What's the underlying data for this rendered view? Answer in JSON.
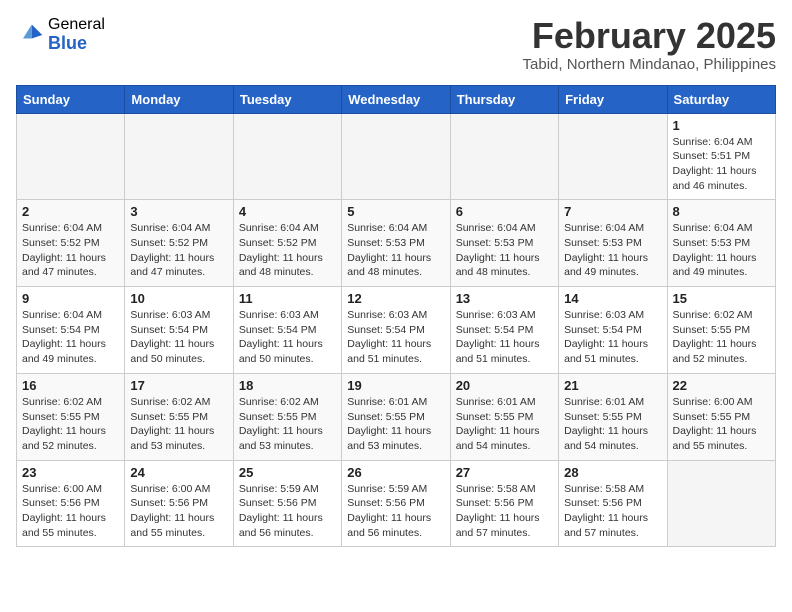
{
  "header": {
    "logo_general": "General",
    "logo_blue": "Blue",
    "month_title": "February 2025",
    "location": "Tabid, Northern Mindanao, Philippines"
  },
  "weekdays": [
    "Sunday",
    "Monday",
    "Tuesday",
    "Wednesday",
    "Thursday",
    "Friday",
    "Saturday"
  ],
  "weeks": [
    [
      {
        "day": "",
        "info": ""
      },
      {
        "day": "",
        "info": ""
      },
      {
        "day": "",
        "info": ""
      },
      {
        "day": "",
        "info": ""
      },
      {
        "day": "",
        "info": ""
      },
      {
        "day": "",
        "info": ""
      },
      {
        "day": "1",
        "info": "Sunrise: 6:04 AM\nSunset: 5:51 PM\nDaylight: 11 hours\nand 46 minutes."
      }
    ],
    [
      {
        "day": "2",
        "info": "Sunrise: 6:04 AM\nSunset: 5:52 PM\nDaylight: 11 hours\nand 47 minutes."
      },
      {
        "day": "3",
        "info": "Sunrise: 6:04 AM\nSunset: 5:52 PM\nDaylight: 11 hours\nand 47 minutes."
      },
      {
        "day": "4",
        "info": "Sunrise: 6:04 AM\nSunset: 5:52 PM\nDaylight: 11 hours\nand 48 minutes."
      },
      {
        "day": "5",
        "info": "Sunrise: 6:04 AM\nSunset: 5:53 PM\nDaylight: 11 hours\nand 48 minutes."
      },
      {
        "day": "6",
        "info": "Sunrise: 6:04 AM\nSunset: 5:53 PM\nDaylight: 11 hours\nand 48 minutes."
      },
      {
        "day": "7",
        "info": "Sunrise: 6:04 AM\nSunset: 5:53 PM\nDaylight: 11 hours\nand 49 minutes."
      },
      {
        "day": "8",
        "info": "Sunrise: 6:04 AM\nSunset: 5:53 PM\nDaylight: 11 hours\nand 49 minutes."
      }
    ],
    [
      {
        "day": "9",
        "info": "Sunrise: 6:04 AM\nSunset: 5:54 PM\nDaylight: 11 hours\nand 49 minutes."
      },
      {
        "day": "10",
        "info": "Sunrise: 6:03 AM\nSunset: 5:54 PM\nDaylight: 11 hours\nand 50 minutes."
      },
      {
        "day": "11",
        "info": "Sunrise: 6:03 AM\nSunset: 5:54 PM\nDaylight: 11 hours\nand 50 minutes."
      },
      {
        "day": "12",
        "info": "Sunrise: 6:03 AM\nSunset: 5:54 PM\nDaylight: 11 hours\nand 51 minutes."
      },
      {
        "day": "13",
        "info": "Sunrise: 6:03 AM\nSunset: 5:54 PM\nDaylight: 11 hours\nand 51 minutes."
      },
      {
        "day": "14",
        "info": "Sunrise: 6:03 AM\nSunset: 5:54 PM\nDaylight: 11 hours\nand 51 minutes."
      },
      {
        "day": "15",
        "info": "Sunrise: 6:02 AM\nSunset: 5:55 PM\nDaylight: 11 hours\nand 52 minutes."
      }
    ],
    [
      {
        "day": "16",
        "info": "Sunrise: 6:02 AM\nSunset: 5:55 PM\nDaylight: 11 hours\nand 52 minutes."
      },
      {
        "day": "17",
        "info": "Sunrise: 6:02 AM\nSunset: 5:55 PM\nDaylight: 11 hours\nand 53 minutes."
      },
      {
        "day": "18",
        "info": "Sunrise: 6:02 AM\nSunset: 5:55 PM\nDaylight: 11 hours\nand 53 minutes."
      },
      {
        "day": "19",
        "info": "Sunrise: 6:01 AM\nSunset: 5:55 PM\nDaylight: 11 hours\nand 53 minutes."
      },
      {
        "day": "20",
        "info": "Sunrise: 6:01 AM\nSunset: 5:55 PM\nDaylight: 11 hours\nand 54 minutes."
      },
      {
        "day": "21",
        "info": "Sunrise: 6:01 AM\nSunset: 5:55 PM\nDaylight: 11 hours\nand 54 minutes."
      },
      {
        "day": "22",
        "info": "Sunrise: 6:00 AM\nSunset: 5:55 PM\nDaylight: 11 hours\nand 55 minutes."
      }
    ],
    [
      {
        "day": "23",
        "info": "Sunrise: 6:00 AM\nSunset: 5:56 PM\nDaylight: 11 hours\nand 55 minutes."
      },
      {
        "day": "24",
        "info": "Sunrise: 6:00 AM\nSunset: 5:56 PM\nDaylight: 11 hours\nand 55 minutes."
      },
      {
        "day": "25",
        "info": "Sunrise: 5:59 AM\nSunset: 5:56 PM\nDaylight: 11 hours\nand 56 minutes."
      },
      {
        "day": "26",
        "info": "Sunrise: 5:59 AM\nSunset: 5:56 PM\nDaylight: 11 hours\nand 56 minutes."
      },
      {
        "day": "27",
        "info": "Sunrise: 5:58 AM\nSunset: 5:56 PM\nDaylight: 11 hours\nand 57 minutes."
      },
      {
        "day": "28",
        "info": "Sunrise: 5:58 AM\nSunset: 5:56 PM\nDaylight: 11 hours\nand 57 minutes."
      },
      {
        "day": "",
        "info": ""
      }
    ]
  ]
}
